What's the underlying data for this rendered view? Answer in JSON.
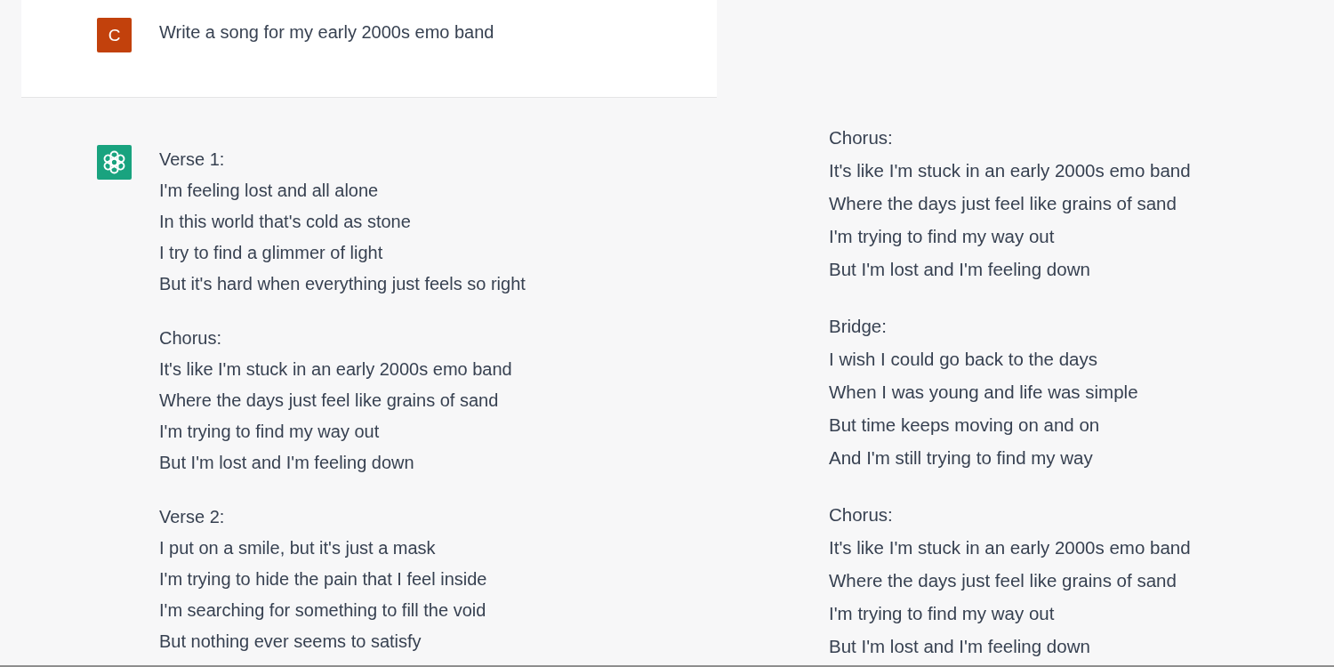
{
  "user_message": {
    "avatar_letter": "C",
    "text": "Write a song for my early 2000s emo band"
  },
  "assistant_message": {
    "stanzas": [
      {
        "heading": "Verse 1:",
        "lines": [
          "I'm feeling lost and all alone",
          "In this world that's cold as stone",
          "I try to find a glimmer of light",
          "But it's hard when everything just feels so right"
        ]
      },
      {
        "heading": "Chorus:",
        "lines": [
          "It's like I'm stuck in an early 2000s emo band",
          "Where the days just feel like grains of sand",
          "I'm trying to find my way out",
          "But I'm lost and I'm feeling down"
        ]
      },
      {
        "heading": "Verse 2:",
        "lines": [
          "I put on a smile, but it's just a mask",
          "I'm trying to hide the pain that I feel inside",
          "I'm searching for something to fill the void",
          "But nothing ever seems to satisfy"
        ]
      }
    ]
  },
  "continued_reply": {
    "stanzas": [
      {
        "heading": "Chorus:",
        "lines": [
          "It's like I'm stuck in an early 2000s emo band",
          "Where the days just feel like grains of sand",
          "I'm trying to find my way out",
          "But I'm lost and I'm feeling down"
        ]
      },
      {
        "heading": "Bridge:",
        "lines": [
          "I wish I could go back to the days",
          "When I was young and life was simple",
          "But time keeps moving on and on",
          "And I'm still trying to find my way"
        ]
      },
      {
        "heading": "Chorus:",
        "lines": [
          "It's like I'm stuck in an early 2000s emo band",
          "Where the days just feel like grains of sand",
          "I'm trying to find my way out",
          "But I'm lost and I'm feeling down"
        ]
      }
    ]
  }
}
